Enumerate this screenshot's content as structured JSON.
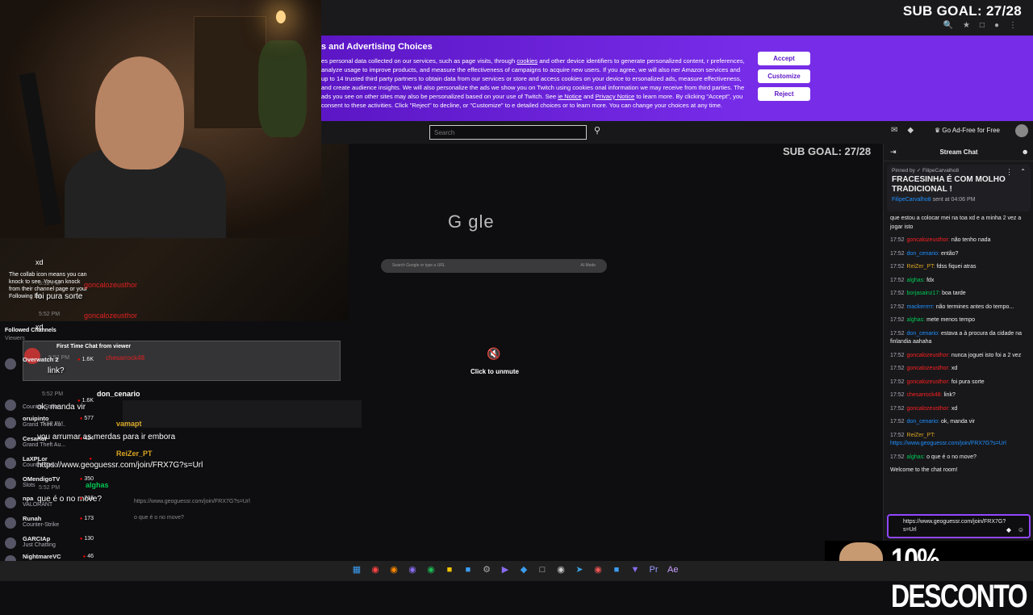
{
  "subgoal_top": "SUB GOAL: 27/28",
  "subgoal_mid": "SUB GOAL: 27/28",
  "consent": {
    "title": "s and Advertising Choices",
    "text_1": "es personal data collected on our services, such as page visits, through",
    "cookies_link": "cookies",
    "text_2": "and other device identifiers to generate personalized content, r preferences, analyze usage to improve products, and measure the effectiveness of campaigns to acquire new users. If you agree, we will also ner Amazon services and up to 14 trusted third party partners to obtain data from our services or store and access cookies on your device to ersonalized ads, measure effectiveness, and create audience insights. We will also personalize the ads we show you on Twitch using cookies onal information we may receive from third parties. The ads you see on other sites may also be personalized based on your use of Twitch. See",
    "cookie_notice_link": "ie Notice",
    "and": "and",
    "privacy_link": "Privacy Notice",
    "text_3": "to learn more. By clicking \"Accept\", you consent to these activities. Click \"Reject\" to decline, or \"Customize\" to e detailed choices or to learn more. You can change your choices at any time.",
    "accept": "Accept",
    "customize": "Customize",
    "reject": "Reject"
  },
  "search": {
    "placeholder": "Search"
  },
  "adfree": "Go Ad-Free for Free",
  "unmute": "Click to unmute",
  "google": {
    "logo": "G    gle",
    "search_placeholder": "Search Google or type a URL",
    "ai_mode": "AI Mode"
  },
  "overlay": {
    "collab_tip": "The collab icon means you can knock to see. You can knock from their channel page or your Following list.",
    "xd": "xd",
    "time_552": "5:52 PM",
    "user_goncalo": "goncalozeusthor",
    "foi_pura_sorte": "foi pura sorte",
    "followed_channels": "Followed Channels",
    "viewers": "Viewers",
    "first_time_chat": "First Time Chat from viewer",
    "user_chesarrock": "chesarrock48",
    "link_q": "link?",
    "user_don": "don_cenario",
    "ok_manda_vir": "ok, manda vir",
    "user_vamapt": "vamapt",
    "vou_arrumar": "vou arrumar as merdas para ir embora",
    "user_reizer": "ReiZer_PT",
    "geo_link": "https://www.geoguessr.com/join/FRX7G?s=Url",
    "user_alghas": "alghas",
    "o_que_e": "que é o no move?",
    "o_que_e_small": "o que é o no move?"
  },
  "channels": [
    {
      "name": "Overwatch 2",
      "game": "",
      "viewers": "1.6K"
    },
    {
      "name": "",
      "game": "Counter-Strike",
      "viewers": "1.6K"
    },
    {
      "name": "oruipinto",
      "game": "Grand Theft Au...",
      "viewers": "577"
    },
    {
      "name": "Cesarlor",
      "game": "Grand Theft Au...",
      "viewers": "424"
    },
    {
      "name": "LaXPLor",
      "game": "Counter-Strike",
      "viewers": ""
    },
    {
      "name": "OMendigoTV",
      "game": "Slots",
      "viewers": "350"
    },
    {
      "name": "npa",
      "game": "VALORANT",
      "viewers": "216"
    },
    {
      "name": "Runah",
      "game": "Counter-Strike",
      "viewers": "173"
    },
    {
      "name": "GARCIAp",
      "game": "Just Chatting",
      "viewers": "130"
    },
    {
      "name": "NightmareVC",
      "game": "",
      "viewers": "46"
    }
  ],
  "chat": {
    "title": "Stream Chat",
    "pinned_by": "Pinned by ✓ FilipeCarvalho8",
    "pinned_msg": "FRACESINHA É COM MOLHO TRADICIONAL !",
    "pinned_user": "FilipeCarvalho8",
    "pinned_sent": "sent at 04:06 PM",
    "messages": [
      {
        "t": "",
        "u": "",
        "cls": "",
        "msg": "que estou a colocar mei na toa xd e a minha 2 vez a jogar isto"
      },
      {
        "t": "17:52",
        "u": "goncalozeusthor:",
        "cls": "u-red",
        "msg": "não tenho nada"
      },
      {
        "t": "17:52",
        "u": "don_cenario:",
        "cls": "u-blue",
        "msg": "então?"
      },
      {
        "t": "17:52",
        "u": "ReiZer_PT:",
        "cls": "u-gold",
        "msg": "fdss fiquei atras"
      },
      {
        "t": "17:52",
        "u": "alghas:",
        "cls": "u-green",
        "msg": "fdx"
      },
      {
        "t": "17:52",
        "u": "borjasainz17:",
        "cls": "u-green",
        "msg": "boa tarde"
      },
      {
        "t": "17:52",
        "u": "mackerrrrr:",
        "cls": "u-blue",
        "msg": "não termines antes do tempo..."
      },
      {
        "t": "17:52",
        "u": "alghas:",
        "cls": "u-green",
        "msg": "mete menos tempo"
      },
      {
        "t": "17:52",
        "u": "don_cenario:",
        "cls": "u-blue",
        "msg": "estava a à procura da cidade na finlandia aahaha"
      },
      {
        "t": "17:52",
        "u": "goncalozeusthor:",
        "cls": "u-red",
        "msg": "nunca joguei isto foi a 2 vez"
      },
      {
        "t": "17:52",
        "u": "goncalozeusthor:",
        "cls": "u-red",
        "msg": "xd"
      },
      {
        "t": "17:52",
        "u": "goncalozeusthor:",
        "cls": "u-red",
        "msg": "foi pura sorte"
      },
      {
        "t": "17:52",
        "u": "chesarrock48:",
        "cls": "u-red",
        "msg": "link?"
      },
      {
        "t": "17:52",
        "u": "goncalozeusthor:",
        "cls": "u-red",
        "msg": "xd"
      },
      {
        "t": "17:52",
        "u": "don_cenario:",
        "cls": "u-blue",
        "msg": "ok, manda vir"
      },
      {
        "t": "17:52",
        "u": "ReiZer_PT:",
        "cls": "u-gold",
        "msg": ""
      },
      {
        "t": "17:52",
        "u": "alghas:",
        "cls": "u-green",
        "msg": "o que é o no move?"
      }
    ],
    "reizer_link": "https://www.geoguessr.com/join/FRX7G?s=Url",
    "welcome": "Welcome to the chat room!",
    "input_value": "https://www.geoguessr.com/join/FRX7G?s=Url"
  },
  "promo": "10% DESCONTO"
}
